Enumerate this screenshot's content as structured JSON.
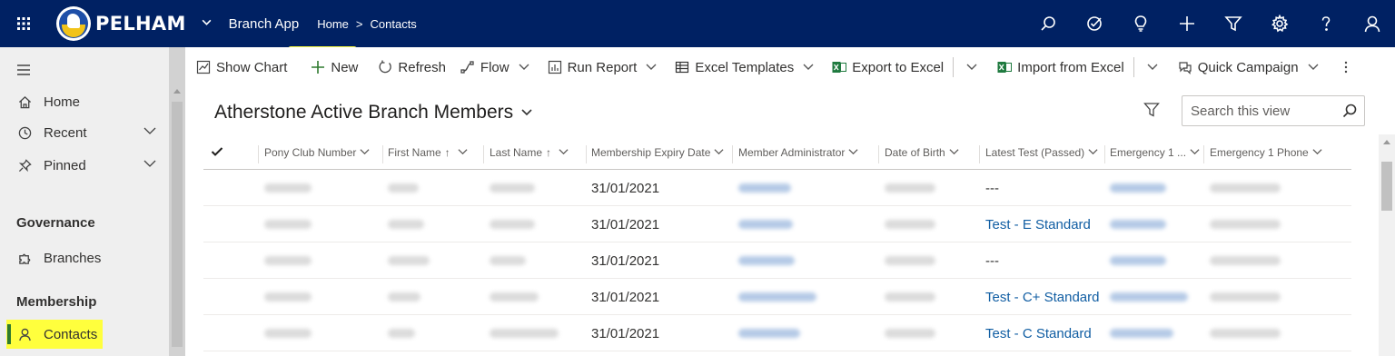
{
  "topbar": {
    "brand": "PELHAM",
    "app_name": "Branch App",
    "breadcrumb_home": "Home",
    "breadcrumb_sep": ">",
    "breadcrumb_current": "Contacts"
  },
  "sidebar": {
    "items": [
      {
        "label": "Home",
        "icon": "home-icon"
      },
      {
        "label": "Recent",
        "icon": "clock-icon"
      },
      {
        "label": "Pinned",
        "icon": "pin-icon"
      }
    ],
    "groups": [
      {
        "title": "Governance",
        "items": [
          {
            "label": "Branches",
            "icon": "puzzle-icon"
          }
        ]
      },
      {
        "title": "Membership",
        "items": [
          {
            "label": "Contacts",
            "icon": "person-icon",
            "active": true
          }
        ]
      }
    ]
  },
  "commandbar": {
    "show_chart": "Show Chart",
    "new": "New",
    "refresh": "Refresh",
    "flow": "Flow",
    "run_report": "Run Report",
    "excel_templates": "Excel Templates",
    "export_excel": "Export to Excel",
    "import_excel": "Import from Excel",
    "quick_campaign": "Quick Campaign"
  },
  "view": {
    "title": "Atherstone Active Branch Members",
    "search_placeholder": "Search this view"
  },
  "grid": {
    "columns": [
      {
        "label": "Pony Club Number",
        "sort": ""
      },
      {
        "label": "First Name",
        "sort": "↑"
      },
      {
        "label": "Last Name",
        "sort": "↑"
      },
      {
        "label": "Membership Expiry Date",
        "sort": ""
      },
      {
        "label": "Member Administrator",
        "sort": ""
      },
      {
        "label": "Date of Birth",
        "sort": ""
      },
      {
        "label": "Latest Test (Passed)",
        "sort": ""
      },
      {
        "label": "Emergency 1 ...",
        "sort": ""
      },
      {
        "label": "Emergency 1 Phone",
        "sort": ""
      }
    ],
    "rows": [
      {
        "expiry": "31/01/2021",
        "latest_test": "---",
        "test_is_link": false
      },
      {
        "expiry": "31/01/2021",
        "latest_test": "Test - E Standard",
        "test_is_link": true
      },
      {
        "expiry": "31/01/2021",
        "latest_test": "---",
        "test_is_link": false
      },
      {
        "expiry": "31/01/2021",
        "latest_test": "Test - C+ Standard",
        "test_is_link": true
      },
      {
        "expiry": "31/01/2021",
        "latest_test": "Test - C Standard",
        "test_is_link": true
      }
    ]
  },
  "colors": {
    "nav_bg": "#002163",
    "highlight": "#ffff3d",
    "link": "#115ea3",
    "new_icon": "#2f7a2f"
  }
}
